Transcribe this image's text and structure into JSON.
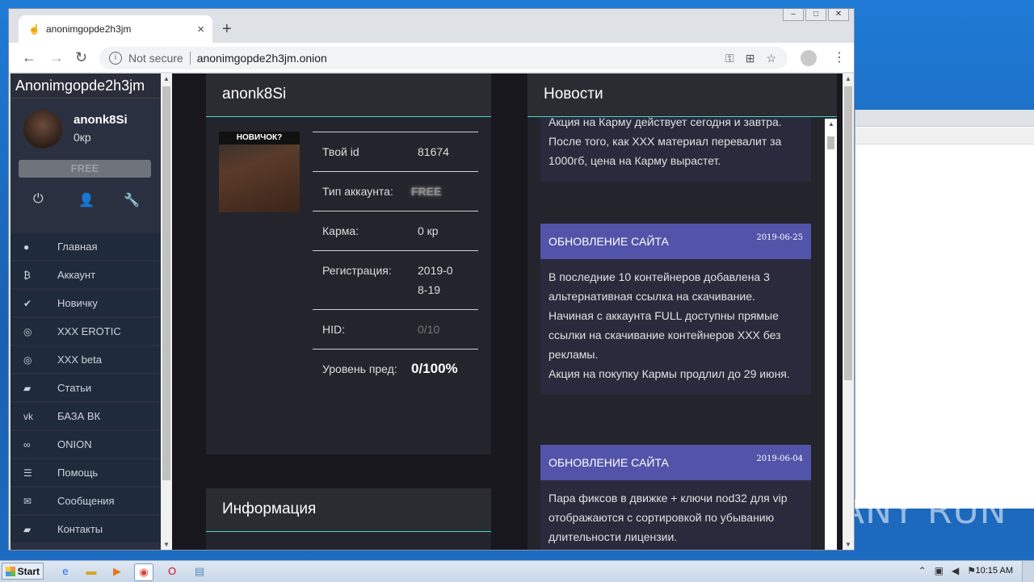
{
  "browser": {
    "tab_title": "anonimgopde2h3jm",
    "new_tab": "+",
    "tab_close": "×",
    "security_label": "Not secure",
    "url": "anonimgopde2h3jm.onion"
  },
  "sidebar": {
    "site_name": "Anonimgopde2h3jm",
    "username": "anonk8Si",
    "karma": "0кр",
    "account_badge": "FREE",
    "items": [
      {
        "icon": "circle-icon",
        "label": "Главная"
      },
      {
        "icon": "bitcoin-icon",
        "label": "Аккаунт"
      },
      {
        "icon": "checkmark-icon",
        "label": "Новичку"
      },
      {
        "icon": "target-icon",
        "label": "XXX EROTIC"
      },
      {
        "icon": "target-icon",
        "label": "XXX beta"
      },
      {
        "icon": "book-icon",
        "label": "Статьи"
      },
      {
        "icon": "vk-icon",
        "label": "БАЗА ВК"
      },
      {
        "icon": "link-icon",
        "label": "ONION"
      },
      {
        "icon": "list-icon",
        "label": "Помощь"
      },
      {
        "icon": "envelope-icon",
        "label": "Сообщения"
      },
      {
        "icon": "book-icon",
        "label": "Контакты"
      }
    ]
  },
  "profile": {
    "title": "anonk8Si",
    "photo_caption": "НОВИЧОК?",
    "rows": [
      {
        "key": "Твой id",
        "value": "81674"
      },
      {
        "key": "Тип аккаунта:",
        "value": "FREE"
      },
      {
        "key": "Карма:",
        "value": "0 кр"
      },
      {
        "key": "Регистрация:",
        "value": "2019-08-19"
      },
      {
        "key": "HID:",
        "value": "0/10"
      },
      {
        "key": "Уровень пред:",
        "value": "0/100%"
      }
    ]
  },
  "info": {
    "title": "Информация"
  },
  "news": {
    "title": "Новости",
    "items": [
      {
        "heading": "",
        "date": "",
        "body": "Акция на Карму действует сегодня и завтра.\nПосле того, как XXX материал перевалит за 1000гб, цена на Карму вырастет."
      },
      {
        "heading": "ОБНОВЛЕНИЕ САЙТА",
        "date": "2019-06-25",
        "body": "В последние 10 контейнеров добавлена 3 альтернативная ссылка на скачивание.\nНачиная с аккаунта FULL доступны прямые ссылки на скачивание контейнеров XXX без рекламы.\nАкция на покупку Кармы продлил до 29 июня."
      },
      {
        "heading": "ОБНОВЛЕНИЕ САЙТА",
        "date": "2019-06-04",
        "body": "Пара фиксов в движке + ключи nod32 для vip отображаются с сортировкой по убыванию длительности лицензии."
      }
    ]
  },
  "taskbar": {
    "start_label": "Start",
    "clock": "10:15 AM"
  },
  "watermark": "ANY RUN"
}
